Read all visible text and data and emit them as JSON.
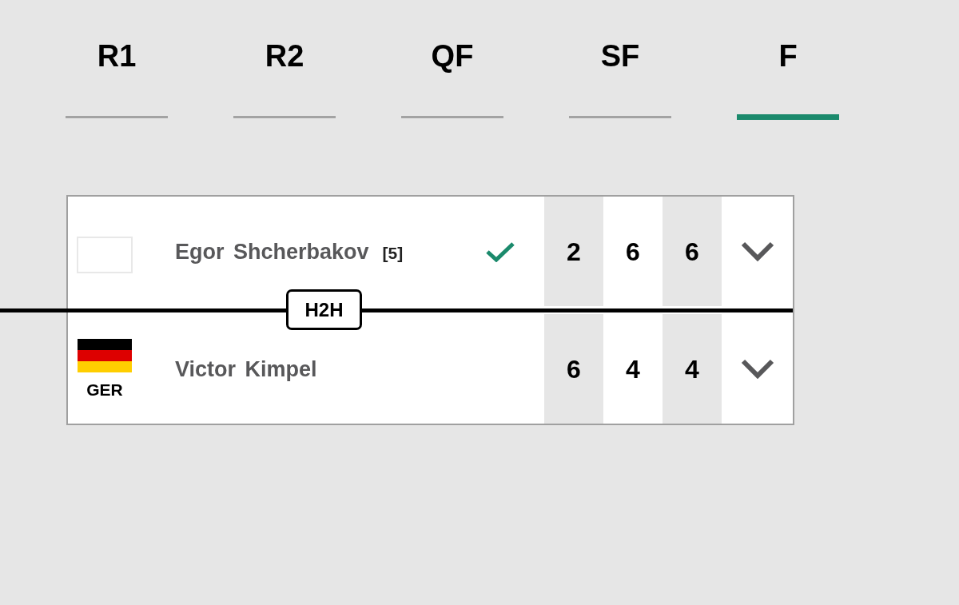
{
  "rounds": [
    {
      "label": "R1",
      "selected": false
    },
    {
      "label": "R2",
      "selected": false
    },
    {
      "label": "QF",
      "selected": false
    },
    {
      "label": "SF",
      "selected": false
    },
    {
      "label": "F",
      "selected": true
    }
  ],
  "match": {
    "players": [
      {
        "name": "Egor Shcherbakov",
        "seed": "[5]",
        "winner": true,
        "sets": [
          "2",
          "6",
          "6"
        ]
      },
      {
        "name": "Victor Kimpel",
        "country": "GER",
        "winner": false,
        "sets": [
          "6",
          "4",
          "4"
        ]
      }
    ],
    "h2h": "H2H"
  }
}
